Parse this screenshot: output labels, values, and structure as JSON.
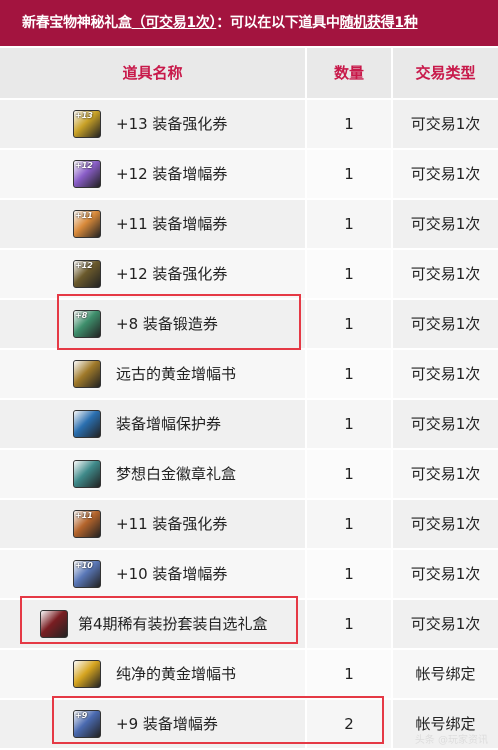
{
  "header": {
    "part1": "新春宝物神秘礼盒",
    "part2": "（可交易1次）",
    "part3": "：可以在以下道具中",
    "part4": "随机获得1种"
  },
  "columns": {
    "name": "道具名称",
    "qty": "数量",
    "trade": "交易类型"
  },
  "items": [
    {
      "tag": "+13",
      "name": "+13 装备强化券",
      "qty": "1",
      "trade": "可交易1次",
      "icon_color": "#c9a227",
      "icon_name": "reinforce-ticket-icon"
    },
    {
      "tag": "+12",
      "name": "+12 装备增幅券",
      "qty": "1",
      "trade": "可交易1次",
      "icon_color": "#8a5ec8",
      "icon_name": "amplify-ticket-icon"
    },
    {
      "tag": "+11",
      "name": "+11 装备增幅券",
      "qty": "1",
      "trade": "可交易1次",
      "icon_color": "#d98a3a",
      "icon_name": "amplify-ticket-icon"
    },
    {
      "tag": "+12",
      "name": "+12 装备强化券",
      "qty": "1",
      "trade": "可交易1次",
      "icon_color": "#6b5a2c",
      "icon_name": "reinforce-ticket-icon"
    },
    {
      "tag": "+8",
      "name": "+8 装备锻造券",
      "qty": "1",
      "trade": "可交易1次",
      "icon_color": "#3e8f6c",
      "icon_name": "forge-ticket-icon"
    },
    {
      "tag": "",
      "name": "远古的黄金增幅书",
      "qty": "1",
      "trade": "可交易1次",
      "icon_color": "#a07a2a",
      "icon_name": "golden-book-icon"
    },
    {
      "tag": "",
      "name": "装备增幅保护券",
      "qty": "1",
      "trade": "可交易1次",
      "icon_color": "#2a6fb0",
      "icon_name": "protect-ticket-icon"
    },
    {
      "tag": "",
      "name": "梦想白金徽章礼盒",
      "qty": "1",
      "trade": "可交易1次",
      "icon_color": "#3f8a8a",
      "icon_name": "badge-box-icon"
    },
    {
      "tag": "+11",
      "name": "+11 装备强化券",
      "qty": "1",
      "trade": "可交易1次",
      "icon_color": "#b5652c",
      "icon_name": "reinforce-ticket-icon"
    },
    {
      "tag": "+10",
      "name": "+10 装备增幅券",
      "qty": "1",
      "trade": "可交易1次",
      "icon_color": "#5a78b8",
      "icon_name": "amplify-ticket-icon"
    },
    {
      "tag": "",
      "name": "第4期稀有装扮套装自选礼盒",
      "qty": "1",
      "trade": "可交易1次",
      "icon_color": "#7a1e22",
      "icon_name": "avatar-box-icon"
    },
    {
      "tag": "",
      "name": "纯净的黄金增幅书",
      "qty": "1",
      "trade": "帐号绑定",
      "icon_color": "#d6a520",
      "icon_name": "golden-book-icon"
    },
    {
      "tag": "+9",
      "name": "+9 装备增幅券",
      "qty": "2",
      "trade": "帐号绑定",
      "icon_color": "#4a6ab0",
      "icon_name": "amplify-ticket-icon"
    }
  ],
  "highlighted_rows": [
    4,
    10,
    12
  ],
  "highlight_color": "#e53945",
  "watermark": "头条 @玩家资讯"
}
